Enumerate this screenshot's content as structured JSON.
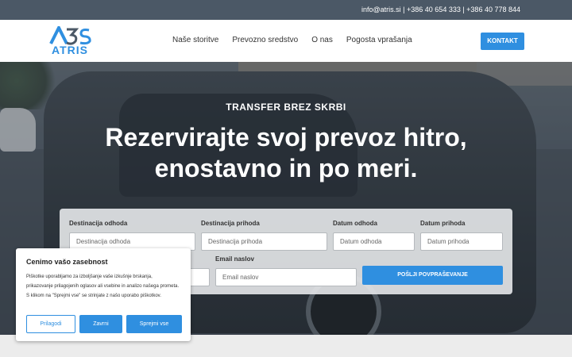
{
  "topbar": {
    "contact": "info@atris.si | +386 40 654 333 | +386 40 778 844"
  },
  "header": {
    "logo_text": "ATRIS",
    "logo_mark": "A3S",
    "nav": [
      "Naše storitve",
      "Prevozno sredstvo",
      "O nas",
      "Pogosta vprašanja"
    ],
    "contact_button": "KONTAKT"
  },
  "hero": {
    "subtitle": "TRANSFER BREZ SKRBI",
    "title_line1": "Rezervirajte svoj prevoz hitro,",
    "title_line2": "enostavno in po meri."
  },
  "form": {
    "fields": [
      {
        "label": "Destinacija odhoda",
        "placeholder": "Destinacija odhoda"
      },
      {
        "label": "Destinacija prihoda",
        "placeholder": "Destinacija prihoda"
      },
      {
        "label": "Datum odhoda",
        "placeholder": "Datum odhoda"
      },
      {
        "label": "Datum prihoda",
        "placeholder": "Datum prihoda"
      },
      {
        "label": "Email naslov",
        "placeholder": "Email naslov"
      }
    ],
    "submit": "POŠLJI POVPRAŠEVANJE"
  },
  "cookie": {
    "title": "Cenimo vašo zasebnost",
    "text": "Piškotke uporabljamo za izboljšanje vaše izkušnje brskanja, prikazovanje prilagojenih oglasov ali vsebine in analizo našega prometa. S klikom na \"Sprejmi vse\" se strinjate z našo uporabo piškotkov.",
    "customize": "Prilagodi",
    "reject": "Zavrni",
    "accept": "Sprejmi vse"
  },
  "colors": {
    "accent": "#2f8fe0",
    "topbar": "#4b5866"
  }
}
